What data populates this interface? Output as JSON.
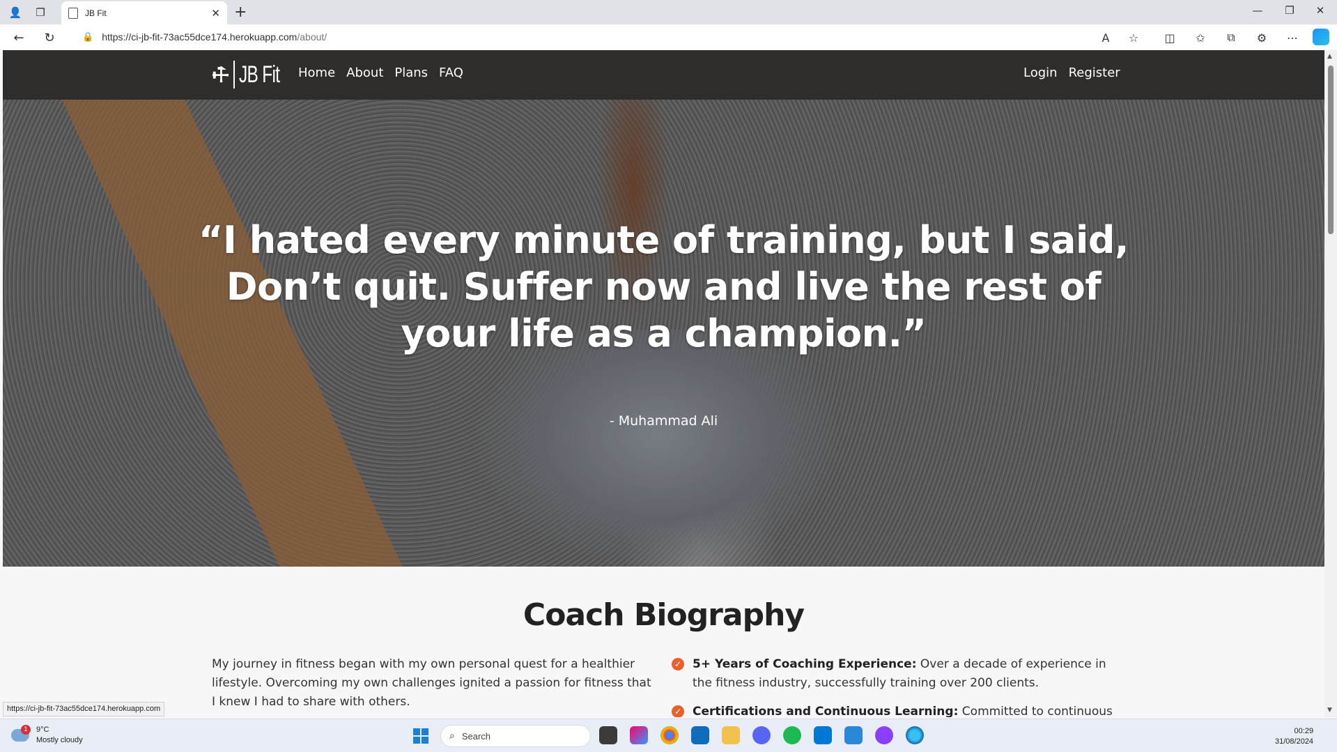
{
  "browser": {
    "tab_title": "JB Fit",
    "url_host": "https://ci-jb-fit-73ac55dce174.herokuapp.com",
    "url_path": "/about/"
  },
  "site": {
    "logo_text": "JB Fit",
    "nav": [
      "Home",
      "About",
      "Plans",
      "FAQ"
    ],
    "auth": [
      "Login",
      "Register"
    ]
  },
  "hero": {
    "quote": "“I hated every minute of training, but I said, Don’t quit. Suffer now and live the rest of your life as a champion.”",
    "author": "- Muhammad Ali"
  },
  "bio": {
    "title": "Coach Biography",
    "left_text": "My journey in fitness began with my own personal quest for a healthier lifestyle. Overcoming my own challenges ignited a passion for fitness that I knew I had to share with others.",
    "items": [
      {
        "heading": "5+ Years of Coaching Experience:",
        "text": " Over a decade of experience in the fitness industry, successfully training over 200 clients."
      },
      {
        "heading": "Certifications and Continuous Learning:",
        "text": " Committed to continuous learning"
      }
    ]
  },
  "status_bar_url": "https://ci-jb-fit-73ac55dce174.herokuapp.com",
  "taskbar": {
    "weather_temp": "9°C",
    "weather_desc": "Mostly cloudy",
    "weather_badge": "1",
    "search_placeholder": "Search",
    "time": "00:29",
    "date": "31/08/2024"
  },
  "colors": {
    "accent": "#e8612c",
    "nav_bg": "#2e2d2b"
  }
}
